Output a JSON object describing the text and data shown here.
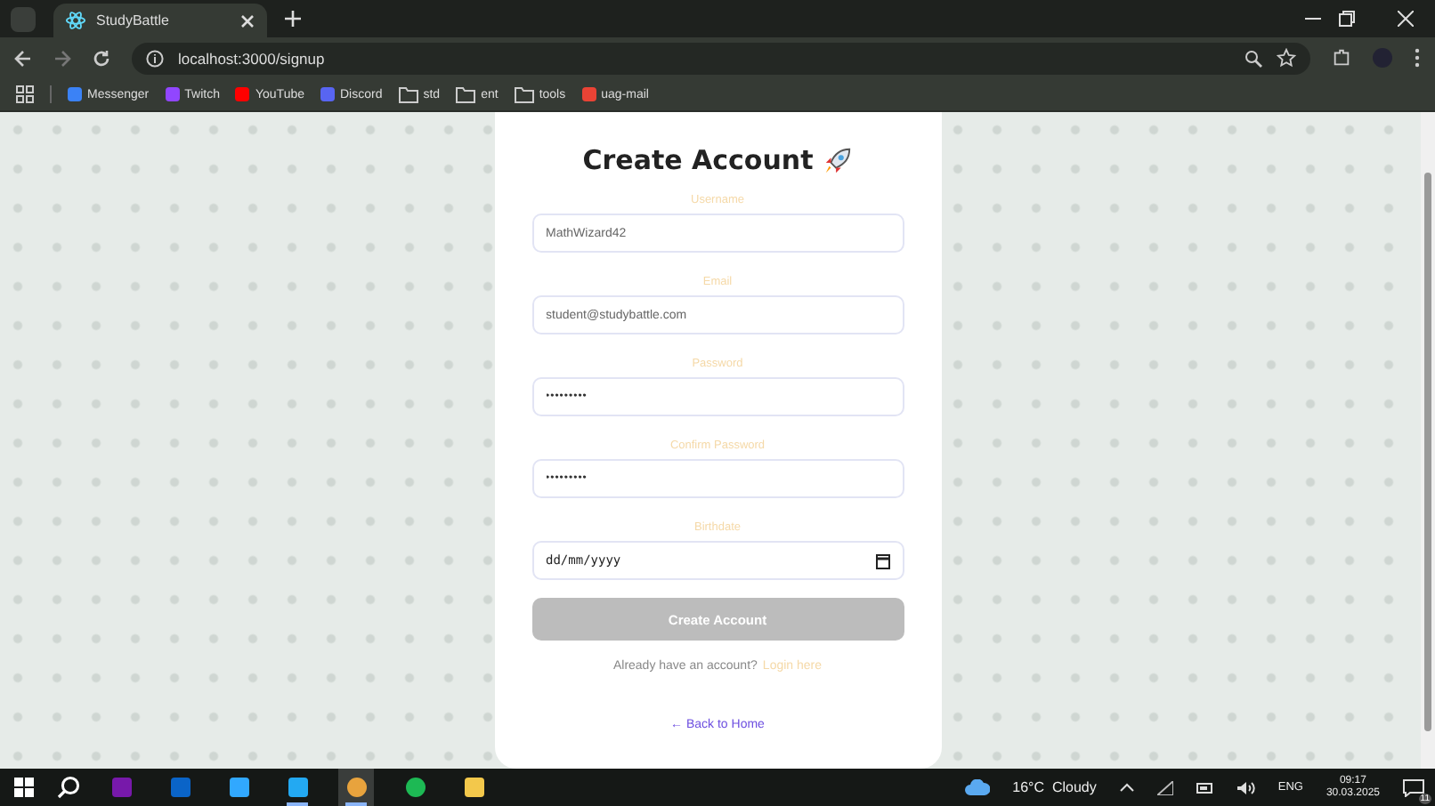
{
  "browser": {
    "tabs": [
      {
        "title": "StudyBattle",
        "selected": true
      }
    ],
    "address": "localhost:3000/signup",
    "bookmarks": [
      {
        "label": "Messenger",
        "kind": "messenger"
      },
      {
        "label": "Twitch",
        "kind": "twitch"
      },
      {
        "label": "YouTube",
        "kind": "youtube"
      },
      {
        "label": "Discord",
        "kind": "discord"
      },
      {
        "label": "std",
        "kind": "folder"
      },
      {
        "label": "ent",
        "kind": "folder"
      },
      {
        "label": "tools",
        "kind": "folder"
      },
      {
        "label": "uag-mail",
        "kind": "gmail"
      }
    ]
  },
  "form": {
    "title": "Create Account",
    "fields": [
      {
        "label": "Username",
        "kind": "text",
        "value": "MathWizard42"
      },
      {
        "label": "Email",
        "kind": "text",
        "value": "student@studybattle.com"
      },
      {
        "label": "Password",
        "kind": "password",
        "value": "•••••••••"
      },
      {
        "label": "Confirm Password",
        "kind": "password",
        "value": "•••••••••"
      },
      {
        "label": "Birthdate",
        "kind": "date",
        "placeholder": "dd/mm/yyyy"
      }
    ],
    "submit": {
      "label": "Create Account",
      "disabled": true
    },
    "login_prompt": "Already have an account?",
    "login_link": "Login here",
    "back_link": "← Back to Home"
  },
  "taskbar": {
    "apps": [
      {
        "kind": "onenote",
        "selected": false,
        "running": false
      },
      {
        "kind": "outlook",
        "selected": false,
        "running": false
      },
      {
        "kind": "photoshop",
        "selected": false,
        "running": false
      },
      {
        "kind": "vscode",
        "selected": false,
        "running": true
      },
      {
        "kind": "chrome",
        "selected": true,
        "running": true
      },
      {
        "kind": "spotify",
        "selected": false,
        "running": false
      },
      {
        "kind": "explorer",
        "selected": false,
        "running": false
      }
    ],
    "weather": "16°C  Cloudy",
    "language": "ENG",
    "time": "09:17",
    "date": "30.03.2025",
    "notifications": "11"
  }
}
